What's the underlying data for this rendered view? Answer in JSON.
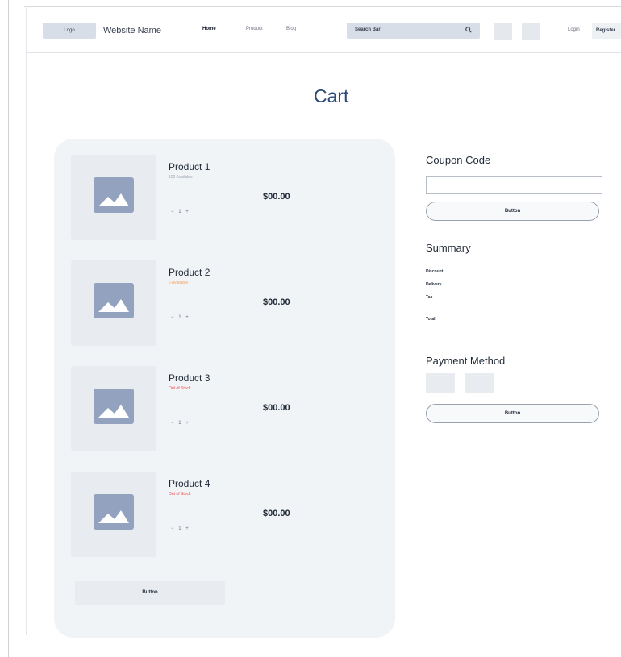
{
  "header": {
    "logo_label": "Logo",
    "site_name": "Website Name",
    "nav": {
      "home": "Home",
      "product": "Product",
      "blog": "Blog"
    },
    "search_placeholder": "Search Bar",
    "login_label": "Login",
    "register_label": "Register"
  },
  "page": {
    "title": "Cart"
  },
  "cart": {
    "items": [
      {
        "name": "Product 1",
        "stock": "100 Available",
        "stock_color": "#9ca3af",
        "quantity": "1",
        "price": "$00.00"
      },
      {
        "name": "Product 2",
        "stock": "5 Available",
        "stock_color": "#f59e5b",
        "quantity": "1",
        "price": "$00.00"
      },
      {
        "name": "Product 3",
        "stock": "Out of Stock",
        "stock_color": "#ef4444",
        "quantity": "1",
        "price": "$00.00"
      },
      {
        "name": "Product 4",
        "stock": "Out of Stock",
        "stock_color": "#ef4444",
        "quantity": "1",
        "price": "$00.00"
      }
    ],
    "button_label": "Button"
  },
  "coupon": {
    "heading": "Coupon Code",
    "input_value": "",
    "button_label": "Button"
  },
  "summary": {
    "heading": "Summary",
    "discount": "Discount",
    "delivery": "Delivery",
    "tax": "Tax",
    "total": "Total"
  },
  "payment": {
    "heading": "Payment Method",
    "button_label": "Button"
  },
  "colors": {
    "accent_title": "#2d4a78",
    "panel_bg": "#f1f4f7",
    "placeholder_img": "#93a3bf"
  },
  "icons": {
    "search": "search-icon",
    "product_image": "image-placeholder-icon"
  }
}
